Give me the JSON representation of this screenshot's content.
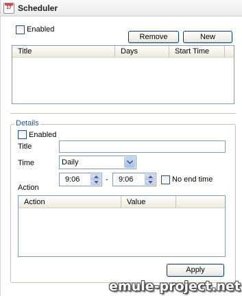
{
  "window": {
    "title": "Scheduler",
    "icon": "calendar-icon"
  },
  "top": {
    "enabled_label": "Enabled",
    "enabled_checked": false,
    "remove_label": "Remove",
    "new_label": "New"
  },
  "schedule_list": {
    "columns": [
      "Title",
      "Days",
      "Start Time"
    ],
    "rows": []
  },
  "details": {
    "group_label": "Details",
    "enabled_label": "Enabled",
    "enabled_checked": false,
    "title_label": "Title",
    "title_value": "",
    "time_label": "Time",
    "time_value": "Daily",
    "start_time": "9:06",
    "dash": "-",
    "end_time": "9:06",
    "no_end_time_label": "No end time",
    "no_end_time_checked": false,
    "action_label": "Action",
    "action_columns": [
      "Action",
      "Value"
    ],
    "action_rows": [],
    "apply_label": "Apply"
  },
  "watermark": "emule-project.net"
}
